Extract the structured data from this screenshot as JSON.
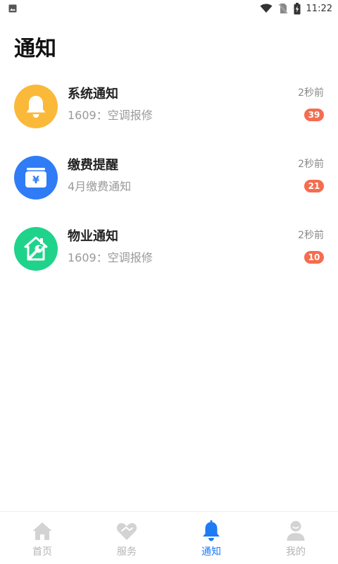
{
  "status_bar": {
    "time": "11:22",
    "icons": [
      "image-icon",
      "wifi-icon",
      "no-sim-icon",
      "battery-charging-icon"
    ]
  },
  "page": {
    "title": "通知"
  },
  "notifications": [
    {
      "title": "系统通知",
      "subtitle": "1609：空调报修",
      "time": "2秒前",
      "badge": "39",
      "icon": "bell-icon",
      "color": "#fbb93a"
    },
    {
      "title": "缴费提醒",
      "subtitle": "4月缴费通知",
      "time": "2秒前",
      "badge": "21",
      "icon": "yuan-wallet-icon",
      "color": "#2f7cf6"
    },
    {
      "title": "物业通知",
      "subtitle": "1609：空调报修",
      "time": "2秒前",
      "badge": "10",
      "icon": "house-wrench-icon",
      "color": "#1fd38a"
    }
  ],
  "tabs": [
    {
      "label": "首页",
      "icon": "home-icon",
      "active": false
    },
    {
      "label": "服务",
      "icon": "heart-handshake-icon",
      "active": false
    },
    {
      "label": "通知",
      "icon": "bell-icon",
      "active": true
    },
    {
      "label": "我的",
      "icon": "user-icon",
      "active": false
    }
  ],
  "colors": {
    "accent": "#1e7bf4",
    "badge": "#f56c4f",
    "tab_inactive": "#b5b5b5"
  }
}
